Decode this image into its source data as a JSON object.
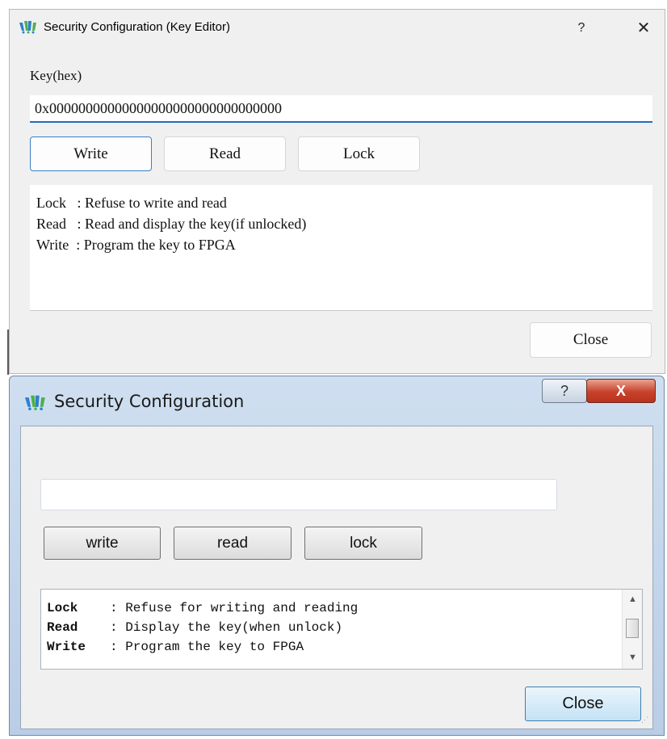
{
  "window1": {
    "title": "Security Configuration (Key Editor)",
    "help_label": "?",
    "close_label": "✕",
    "key_label": "Key(hex)",
    "key_value": "0x00000000000000000000000000000000",
    "buttons": {
      "write": "Write",
      "read": "Read",
      "lock": "Lock"
    },
    "description_lines": [
      "Lock   : Refuse to write and read",
      "Read   : Read and display the key(if unlocked)",
      "Write  : Program the key to FPGA"
    ],
    "close_button": "Close"
  },
  "window2": {
    "title": "Security Configuration",
    "help_label": "?",
    "close_label": "X",
    "key_value": "",
    "buttons": {
      "write": "write",
      "read": "read",
      "lock": "lock"
    },
    "description": [
      {
        "term": "Lock",
        "text": ": Refuse for writing and reading"
      },
      {
        "term": "Read",
        "text": ": Display the key(when unlock)"
      },
      {
        "term": "Write",
        "text": ": Program the key to FPGA"
      }
    ],
    "close_button": "Close"
  },
  "colors": {
    "accent_blue": "#1f6fc0",
    "win7_close_red": "#c7412b",
    "win7_frame": "#b9cde6"
  },
  "icons": {
    "app_logo": "gowin-logo-icon",
    "help": "question-icon",
    "close": "close-icon"
  }
}
